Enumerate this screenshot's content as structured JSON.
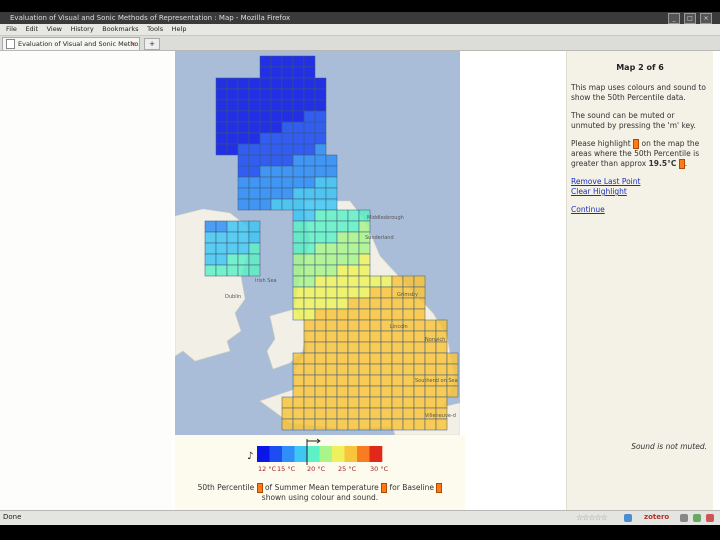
{
  "window": {
    "title": "Evaluation of Visual and Sonic Methods of Representation : Map - Mozilla Firefox",
    "buttons": [
      "minimize",
      "maximize",
      "close"
    ]
  },
  "menubar": [
    "File",
    "Edit",
    "View",
    "History",
    "Bookmarks",
    "Tools",
    "Help"
  ],
  "tab": {
    "label": "Evaluation of Visual and Sonic Metho...",
    "close": "×",
    "new_tab": "+"
  },
  "map": {
    "place_labels": [
      "Irish Sea",
      "Dublin",
      "Grimsby",
      "Southend on Sea",
      "Villeneuve-d",
      "Sunderland",
      "Middlesbrough",
      "Lincoln",
      "Norwich"
    ],
    "sea_color": "#a9bdd8",
    "land_color": "#f2efe6"
  },
  "legend": {
    "ticks": [
      "12 °C",
      "15 °C",
      "20 °C",
      "25 °C",
      "30 °C"
    ],
    "caption_line1": "50th Percentile",
    "caption_of": "of Summer Mean temperature",
    "caption_for": "for Baseline",
    "caption_line2": "shown using colour and sound.",
    "colormap": [
      "#0a16e8",
      "#1d4cf5",
      "#2f8ef8",
      "#3fc6f2",
      "#5ef0c6",
      "#a8f58a",
      "#eef15c",
      "#f8c43c",
      "#f77c22",
      "#e2281a"
    ]
  },
  "panel": {
    "title": "Map 2 of 6",
    "para1": "This map uses colours and sound to show the 50th Percentile data.",
    "para2": "The sound can be muted or unmuted by pressing the 'm' key.",
    "para3_a": "Please highlight",
    "para3_b": "on the map the areas where the 50th Percentile is greater than approx",
    "para3_value": "19.5°C",
    "link_remove": "Remove Last Point",
    "link_clear": "Clear Highlight",
    "link_continue": "Continue",
    "sound_status": "Sound is not muted."
  },
  "statusbar": {
    "text": "Done",
    "zotero": "zotero"
  },
  "colors": {
    "chip": "#ff7b1a",
    "link": "#1a2fbf"
  }
}
